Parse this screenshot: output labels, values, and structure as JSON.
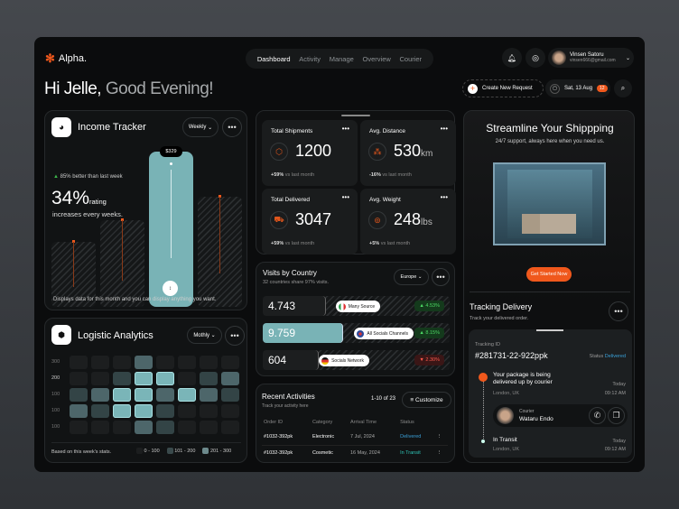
{
  "brand": {
    "name": "Alpha."
  },
  "nav": [
    "Dashboard",
    "Activity",
    "Manage",
    "Overview",
    "Courier"
  ],
  "user": {
    "name": "Vinsen Satoru",
    "email": "vinsen666@gmail.com"
  },
  "greeting": {
    "name": "Hi Jelle,",
    "text": "Good Evening!"
  },
  "actions": {
    "create": "Create New Request",
    "date": "Sat, 13 Aug",
    "date_badge": "12"
  },
  "income": {
    "title": "Income Tracker",
    "period": "Weekly",
    "trend": "85% better than last week",
    "rating": "34%",
    "rating_unit": "rating",
    "rating_sub": "increases every weeks.",
    "tooltip": "$329",
    "footer": "Displays data for this month and you can display anything you want.",
    "bars": [
      0.42,
      0.56,
      1.0,
      0.71
    ],
    "highlight_index": 2
  },
  "logistics": {
    "title": "Logistic Analytics",
    "period": "Mothly",
    "ylabels": [
      "300",
      "200",
      "100",
      "100",
      "100"
    ],
    "grid": [
      [
        0,
        0,
        0,
        2,
        0,
        0,
        0,
        0
      ],
      [
        0,
        0,
        1,
        3,
        3,
        0,
        1,
        2
      ],
      [
        1,
        2,
        3,
        3,
        2,
        3,
        2,
        1
      ],
      [
        2,
        1,
        3,
        3,
        1,
        0,
        0,
        0
      ],
      [
        0,
        0,
        0,
        2,
        1,
        0,
        0,
        0
      ]
    ],
    "colors": [
      "#1c1e1f",
      "#334446",
      "#4d666a",
      "#7ab5b8"
    ],
    "footer": "Based on this week's stats.",
    "legend": [
      "0 - 100",
      "101 - 200",
      "201 - 300"
    ]
  },
  "stats": [
    {
      "title": "Total Shipments",
      "value": "1200",
      "unit": "",
      "change": "+59%",
      "note": "vs last month",
      "icon": "box-icon"
    },
    {
      "title": "Avg. Distance",
      "value": "530",
      "unit": "km",
      "change": "-16%",
      "note": "vs last month",
      "icon": "route-icon"
    },
    {
      "title": "Total Delivered",
      "value": "3047",
      "unit": "",
      "change": "+59%",
      "note": "vs last month",
      "icon": "truck-icon"
    },
    {
      "title": "Avg. Weight",
      "value": "248",
      "unit": "lbs",
      "change": "+5%",
      "note": "vs last month",
      "icon": "scale-icon"
    }
  ],
  "visits": {
    "title": "Visits by Country",
    "subtitle": "32 countries share 97% visits.",
    "region": "Europe",
    "rows": [
      {
        "value": "4.743",
        "source": "Many Source",
        "change": "4.53%",
        "up": true
      },
      {
        "value": "9.759",
        "source": "All Socials Channels",
        "change": "8.15%",
        "up": true
      },
      {
        "value": "604",
        "source": "Socials Network",
        "change": "2.30%",
        "up": false
      }
    ]
  },
  "recent": {
    "title": "Recent Activities",
    "subtitle": "Track your activity here",
    "range": "1-10 of 23",
    "customize": "Customize",
    "columns": [
      "Order ID",
      "Category",
      "Arrival Time",
      "Status"
    ],
    "rows": [
      [
        "#1032-392pk",
        "Electronic",
        "7 Jul, 2024",
        "Delivered"
      ],
      [
        "#1032-392pk",
        "Cosmetic",
        "16 May, 2024",
        "In Transit"
      ]
    ]
  },
  "promo": {
    "title": "Streamline Your Shippping",
    "subtitle": "24/7 support, always here when you need us.",
    "cta": "Get Started Now"
  },
  "tracking": {
    "title": "Tracking Delivery",
    "subtitle": "Track your delivered order.",
    "id_label": "Tracking ID",
    "id": "#281731-22-922ppk",
    "status_label": "Status",
    "status": "Delivered",
    "step1": {
      "text": "Your package is being delivered up by courier",
      "place": "London, UK",
      "day": "Today",
      "time": "09:12 AM"
    },
    "courier_label": "Courier",
    "courier": "Wataru Endo",
    "step2": {
      "text": "In Transit",
      "place": "London, UK",
      "day": "Today",
      "time": "09:12 AM"
    }
  },
  "accent": "#f0581c"
}
